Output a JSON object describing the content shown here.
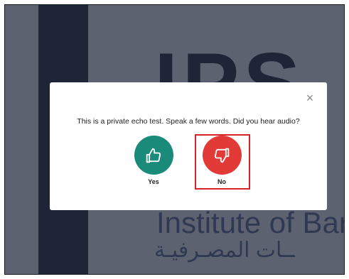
{
  "background": {
    "brand_text": "IPS",
    "institute_text": "Institute of Bar",
    "arabic_text": "ــات المصـرفيـة"
  },
  "modal": {
    "close_glyph": "×",
    "question": "This is a private echo test. Speak a few words. Did you hear audio?",
    "yes_label": "Yes",
    "no_label": "No",
    "yes_icon": "thumbs-up-icon",
    "no_icon": "thumbs-down-icon"
  },
  "colors": {
    "yes": "#1a8a7a",
    "no": "#e23a36",
    "highlight": "#d8222a",
    "overlay": "#5c6270",
    "brand_dark": "#1d2536"
  }
}
